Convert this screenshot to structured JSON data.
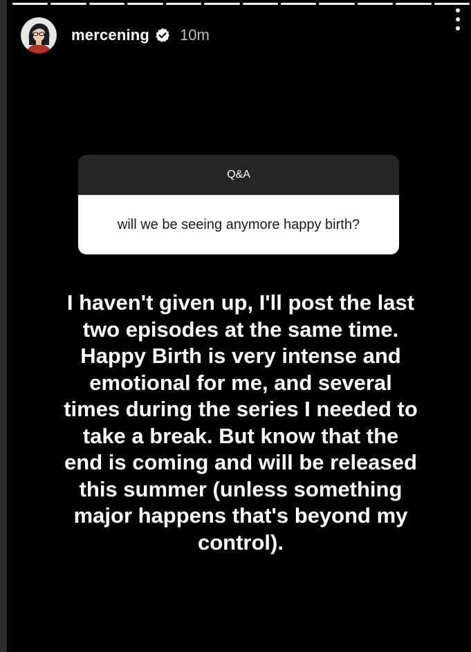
{
  "story": {
    "progress_segments": 12,
    "username": "mercening",
    "verified": true,
    "time_ago": "10m",
    "menu_icon": "more-vertical-icon"
  },
  "qa": {
    "header_label": "Q&A",
    "question": "will we be seeing anymore happy birth?"
  },
  "answer": {
    "text": "I haven't given up, I'll post the last two episodes at the same time. Happy Birth is very intense and emotional for me, and several times during the series I needed to take a break. But know that the end is coming and will be released this summer (unless something major happens that's beyond my control)."
  },
  "colors": {
    "background": "#000000",
    "text": "#ffffff",
    "qa_header": "#262626",
    "qa_body": "#ffffff"
  }
}
